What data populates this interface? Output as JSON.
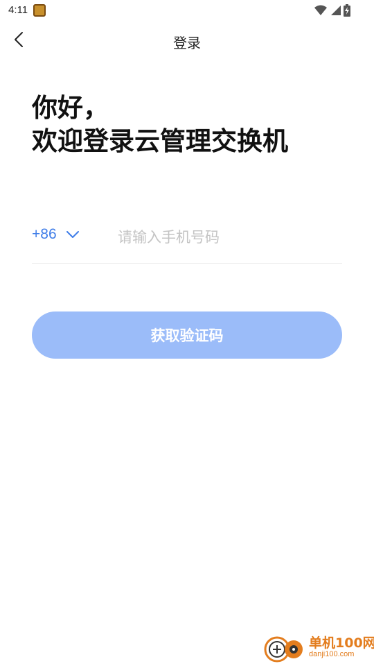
{
  "status_bar": {
    "time": "4:11",
    "icons": [
      "app-notification-icon",
      "wifi-icon",
      "signal-icon",
      "battery-charging-icon"
    ]
  },
  "nav": {
    "back_icon": "chevron-left-icon",
    "title": "登录"
  },
  "greeting": {
    "line1": "你好，",
    "line2": "欢迎登录云管理交换机"
  },
  "phone": {
    "country_code": "+86",
    "dropdown_icon": "chevron-down-icon",
    "value": "",
    "placeholder": "请输入手机号码"
  },
  "actions": {
    "get_code_label": "获取验证码"
  },
  "watermark": {
    "name": "单机100网",
    "domain": "danji100.com"
  },
  "colors": {
    "accent": "#3f7de8",
    "button_disabled": "#9bbcf9",
    "watermark": "#e37d1e"
  }
}
